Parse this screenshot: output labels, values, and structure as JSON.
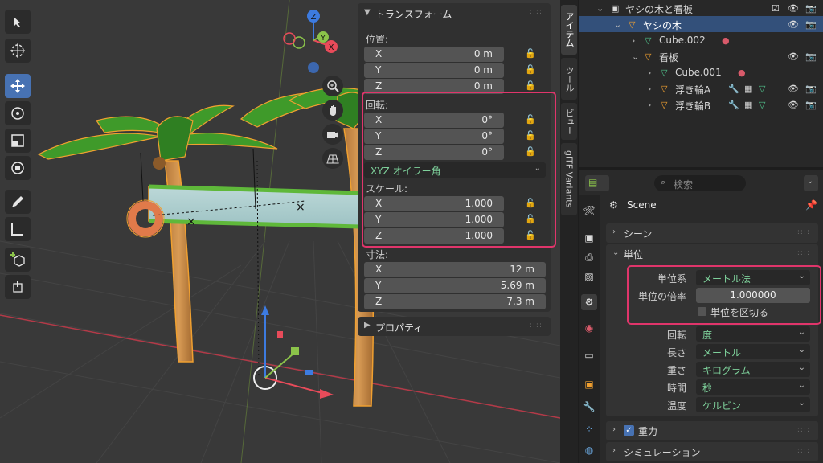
{
  "transform": {
    "title": "トランスフォーム",
    "location_label": "位置:",
    "location": [
      {
        "axis": "X",
        "value": "0 m"
      },
      {
        "axis": "Y",
        "value": "0 m"
      },
      {
        "axis": "Z",
        "value": "0 m"
      }
    ],
    "rotation_label": "回転:",
    "rotation": [
      {
        "axis": "X",
        "value": "0°"
      },
      {
        "axis": "Y",
        "value": "0°"
      },
      {
        "axis": "Z",
        "value": "0°"
      }
    ],
    "rotation_mode": "XYZ オイラー角",
    "scale_label": "スケール:",
    "scale": [
      {
        "axis": "X",
        "value": "1.000"
      },
      {
        "axis": "Y",
        "value": "1.000"
      },
      {
        "axis": "Z",
        "value": "1.000"
      }
    ],
    "dimensions_label": "寸法:",
    "dimensions": [
      {
        "axis": "X",
        "value": "12 m"
      },
      {
        "axis": "Y",
        "value": "5.69 m"
      },
      {
        "axis": "Z",
        "value": "7.3 m"
      }
    ]
  },
  "properties_panel": {
    "title": "プロパティ"
  },
  "side_tabs": [
    "アイテム",
    "ツール",
    "ビュー",
    "glTF Variants"
  ],
  "outliner": {
    "rows": [
      {
        "name": "ヤシの木と看板"
      },
      {
        "name": "ヤシの木"
      },
      {
        "name": "Cube.002"
      },
      {
        "name": "看板"
      },
      {
        "name": "Cube.001"
      },
      {
        "name": "浮き輪A"
      },
      {
        "name": "浮き輪B"
      }
    ]
  },
  "props": {
    "search_placeholder": "検索",
    "scene_name": "Scene",
    "scene_section": "シーン",
    "units_section": "単位",
    "unit_system_label": "単位系",
    "unit_system_value": "メートル法",
    "unit_scale_label": "単位の倍率",
    "unit_scale_value": "1.000000",
    "separate_units_label": "単位を区切る",
    "rotation_label": "回転",
    "rotation_value": "度",
    "length_label": "長さ",
    "length_value": "メートル",
    "mass_label": "重さ",
    "mass_value": "キログラム",
    "time_label": "時間",
    "time_value": "秒",
    "temperature_label": "温度",
    "temperature_value": "ケルビン",
    "gravity_section": "重力",
    "simulation_section": "シミュレーション"
  },
  "gizmo": {
    "x": "X",
    "y": "Y",
    "z": "Z"
  },
  "colors": {
    "accent": "#4772b3",
    "highlight": "#e0356b",
    "x_axis": "#e84b5a",
    "y_axis": "#8bc34a",
    "z_axis": "#3d7be0"
  }
}
